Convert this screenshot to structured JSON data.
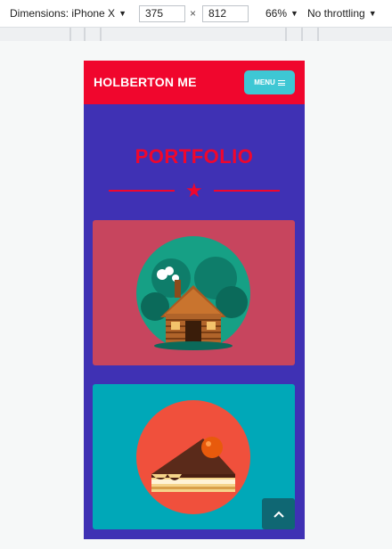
{
  "devtools": {
    "dimensions_label": "Dimensions: iPhone X",
    "width_value": "375",
    "times_symbol": "×",
    "height_value": "812",
    "zoom": "66%",
    "throttling": "No throttling"
  },
  "site": {
    "brand": "HOLBERTON ME",
    "menu_label": "MENU",
    "section_title": "PORTFOLIO"
  },
  "colors": {
    "navbar": "#f0062d",
    "page_bg": "#3f31b4",
    "card_1": "#c7455e",
    "card_2": "#00a8b8",
    "menu_button": "#3ec7d4"
  },
  "portfolio": [
    {
      "icon": "log-cabin-icon"
    },
    {
      "icon": "cake-slice-icon"
    }
  ],
  "back_to_top_icon": "chevron-up-icon"
}
